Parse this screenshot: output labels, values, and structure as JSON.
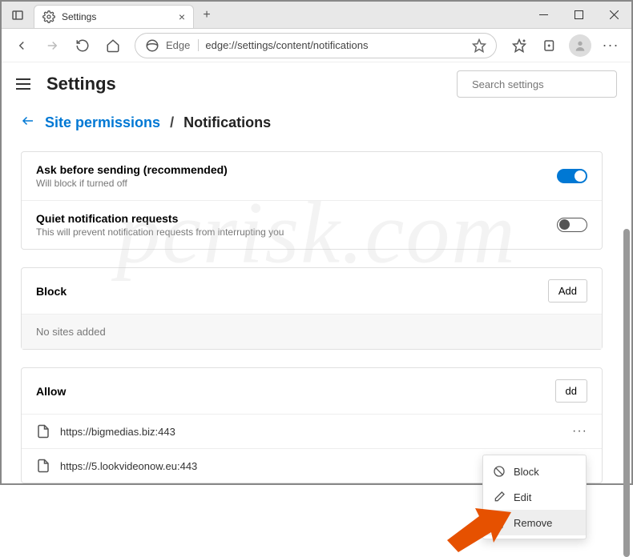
{
  "window": {
    "tab_title": "Settings",
    "address_label": "Edge",
    "url": "edge://settings/content/notifications"
  },
  "header": {
    "title": "Settings",
    "search_placeholder": "Search settings"
  },
  "breadcrumb": {
    "parent": "Site permissions",
    "sep": "/",
    "current": "Notifications"
  },
  "settings": [
    {
      "title": "Ask before sending (recommended)",
      "desc": "Will block if turned off",
      "on": true
    },
    {
      "title": "Quiet notification requests",
      "desc": "This will prevent notification requests from interrupting you",
      "on": false
    }
  ],
  "block": {
    "title": "Block",
    "add": "Add",
    "empty": "No sites added"
  },
  "allow": {
    "title": "Allow",
    "add": "dd",
    "sites": [
      "https://bigmedias.biz:443",
      "https://5.lookvideonow.eu:443"
    ]
  },
  "context_menu": {
    "block": "Block",
    "edit": "Edit",
    "remove": "Remove"
  },
  "watermark": "pcrisk.com"
}
